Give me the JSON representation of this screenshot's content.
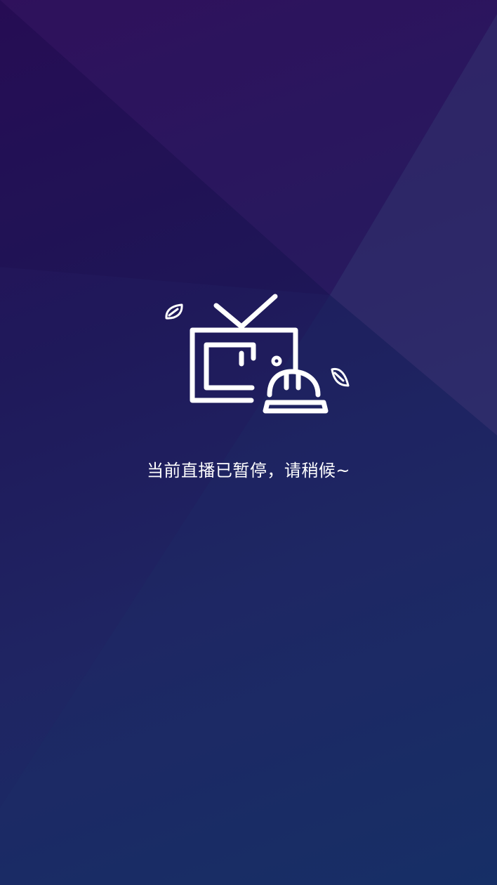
{
  "status": {
    "message": "当前直播已暂停，请稍候~"
  },
  "illustration": {
    "icons": [
      "tv-icon",
      "hard-hat-icon",
      "leaf-icon"
    ],
    "stroke_color": "#ffffff"
  },
  "colors": {
    "background_top": "#2a0d57",
    "background_bottom": "#152f66",
    "text": "#ffffff"
  }
}
